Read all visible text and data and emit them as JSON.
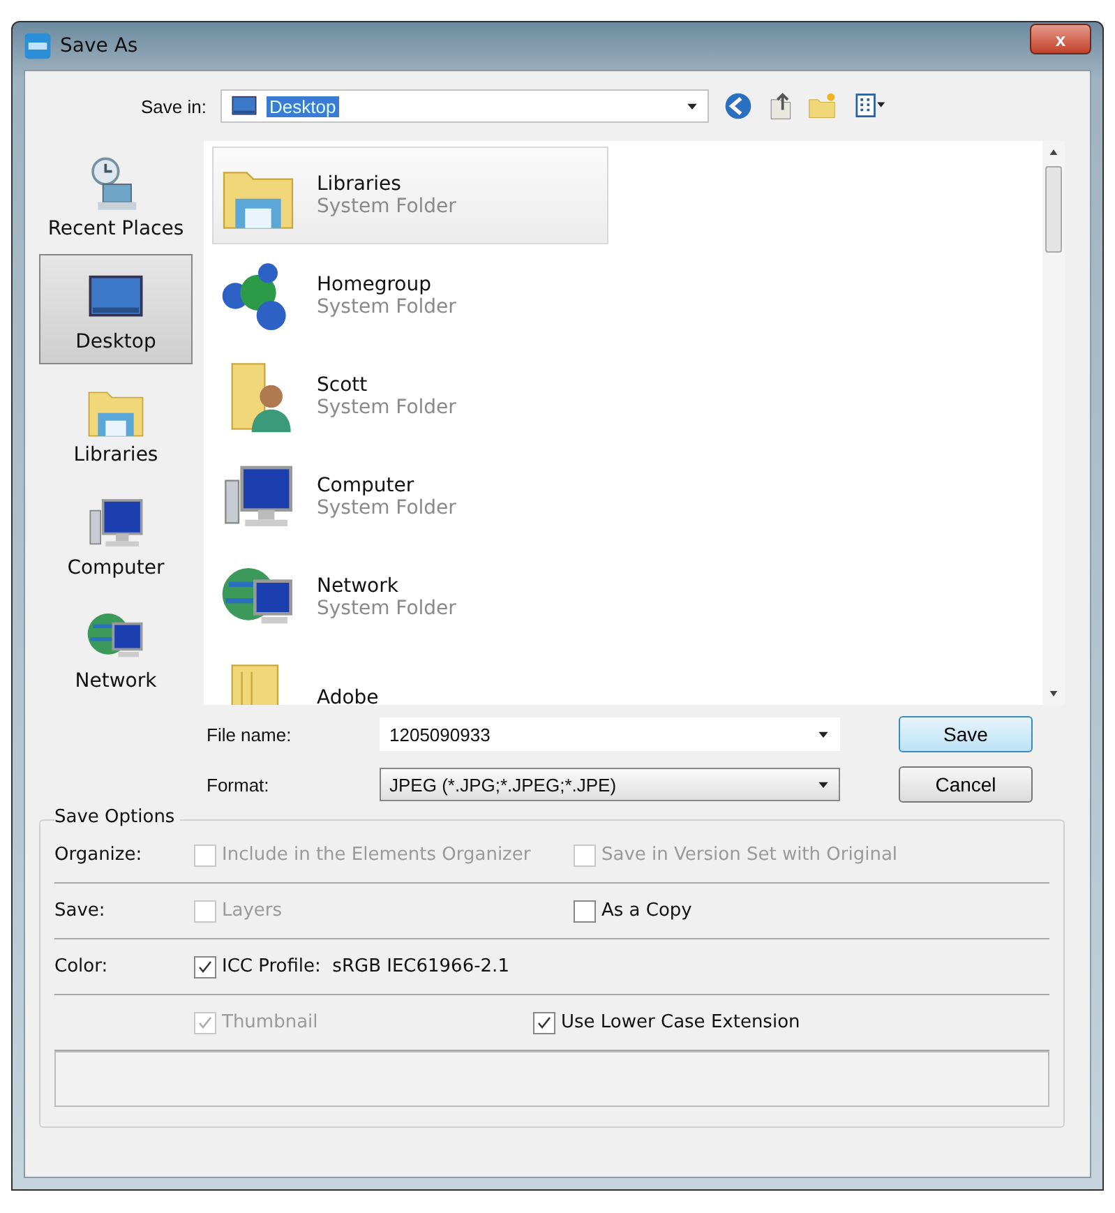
{
  "window": {
    "title": "Save As",
    "close": "x"
  },
  "save_in": {
    "label": "Save in:",
    "value": "Desktop"
  },
  "sidebar": {
    "items": [
      {
        "label": "Recent Places",
        "kind": "recent",
        "selected": false
      },
      {
        "label": "Desktop",
        "kind": "desktop",
        "selected": true
      },
      {
        "label": "Libraries",
        "kind": "library",
        "selected": false
      },
      {
        "label": "Computer",
        "kind": "computer",
        "selected": false
      },
      {
        "label": "Network",
        "kind": "network",
        "selected": false
      }
    ]
  },
  "files": [
    {
      "name": "Libraries",
      "type": "System Folder",
      "kind": "library",
      "selected": true
    },
    {
      "name": "Homegroup",
      "type": "System Folder",
      "kind": "homegroup",
      "selected": false
    },
    {
      "name": "Scott",
      "type": "System Folder",
      "kind": "user",
      "selected": false
    },
    {
      "name": "Computer",
      "type": "System Folder",
      "kind": "computer",
      "selected": false
    },
    {
      "name": "Network",
      "type": "System Folder",
      "kind": "network",
      "selected": false
    },
    {
      "name": "Adobe",
      "kind": "folder",
      "selected": false
    }
  ],
  "file_name": {
    "label": "File name:",
    "value": "1205090933"
  },
  "format": {
    "label": "Format:",
    "value": "JPEG (*.JPG;*.JPEG;*.JPE)"
  },
  "buttons": [
    {
      "label": "Save",
      "default": true
    },
    {
      "label": "Cancel",
      "default": false
    }
  ],
  "save_options": {
    "title": "Save Options",
    "rows": [
      {
        "label": "Organize:",
        "options": [
          {
            "label": "Include in the Elements Organizer",
            "checked": false,
            "disabled": true
          },
          {
            "label": "Save in Version Set with Original",
            "checked": false,
            "disabled": true
          }
        ]
      },
      {
        "label": "Save:",
        "options": [
          {
            "label": "Layers",
            "checked": false,
            "disabled": true
          },
          {
            "label": "As a Copy",
            "checked": false,
            "disabled": false
          }
        ]
      },
      {
        "label": "Color:",
        "options": [
          {
            "label": "ICC Profile:  sRGB IEC61966-2.1",
            "checked": true,
            "disabled": false
          }
        ]
      },
      {
        "options": [
          {
            "label": "Thumbnail",
            "checked": true,
            "disabled": true
          },
          {
            "label": "Use Lower Case Extension",
            "checked": true,
            "disabled": false
          }
        ]
      }
    ]
  }
}
